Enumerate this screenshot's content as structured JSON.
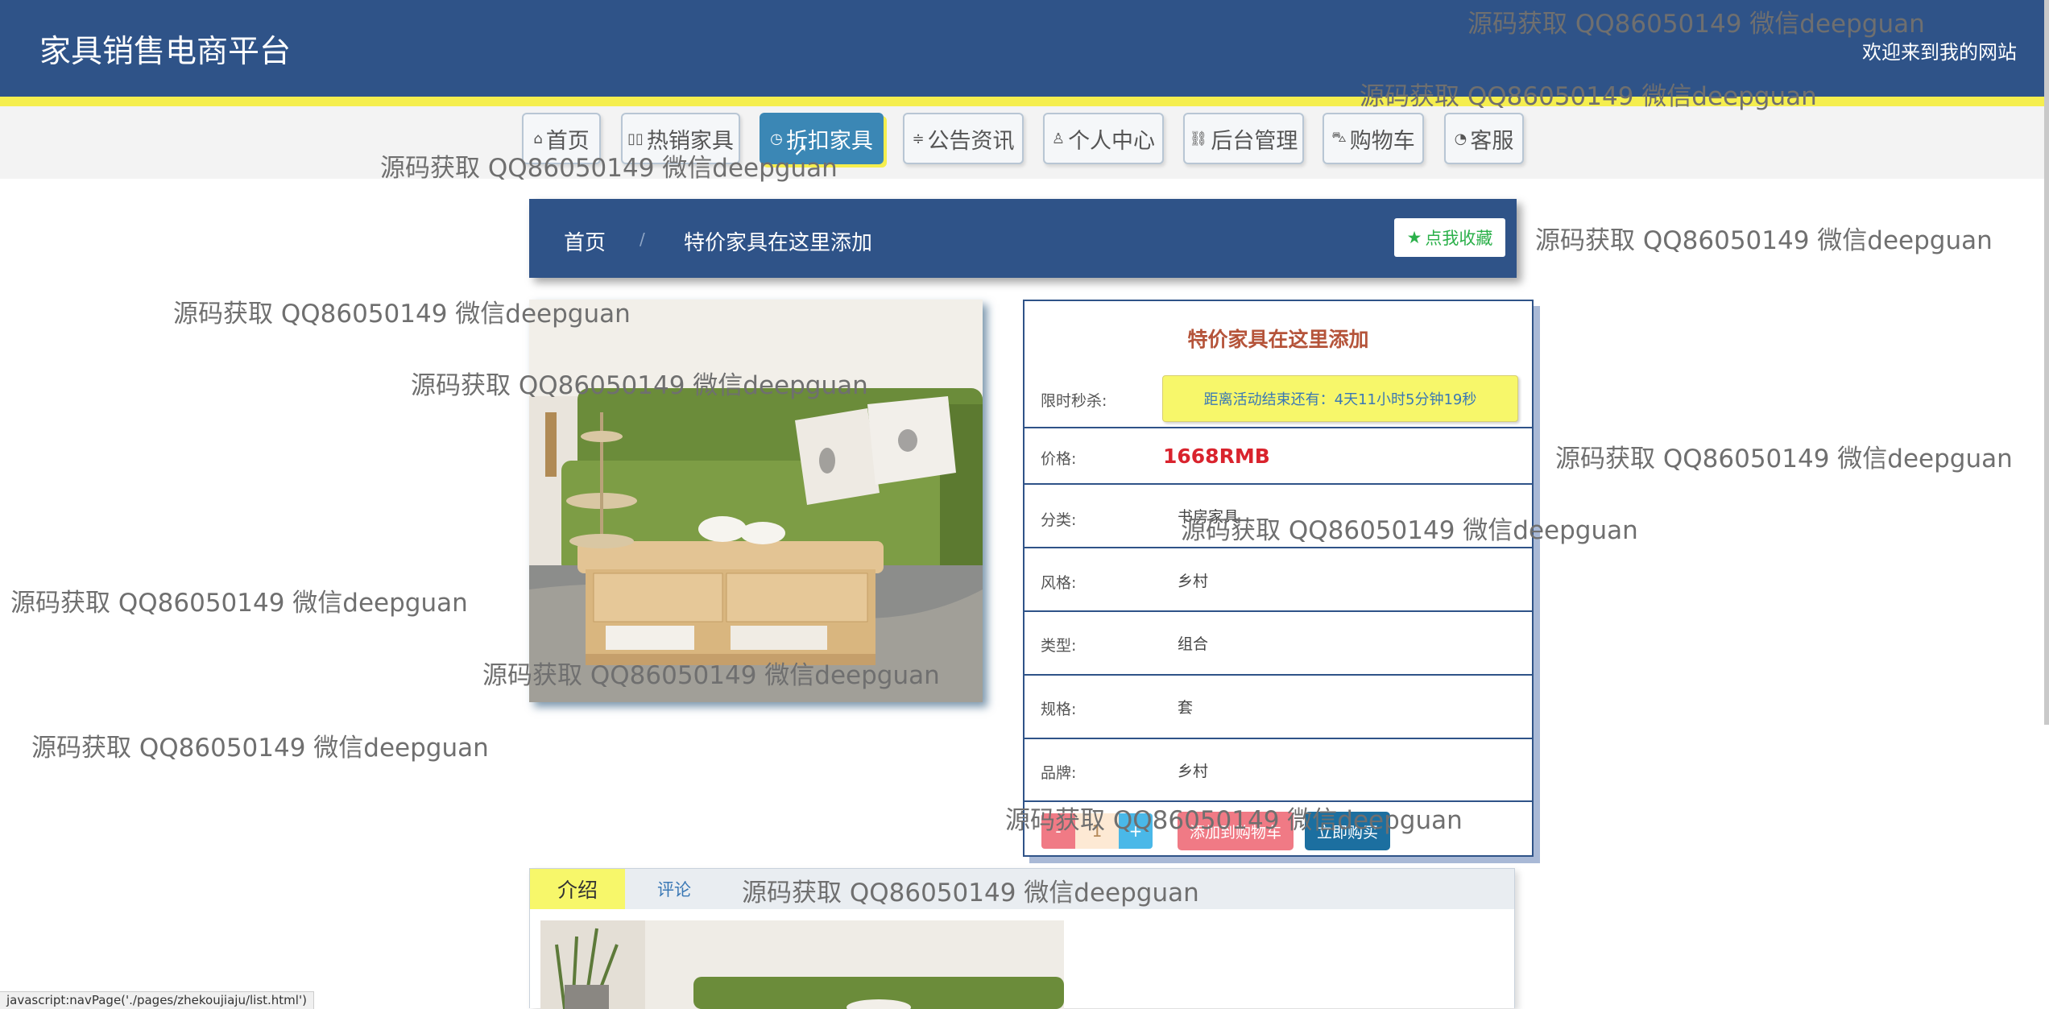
{
  "header": {
    "brand": "家具销售电商平台",
    "welcome": "欢迎来到我的网站"
  },
  "nav": [
    {
      "label": "首页",
      "icon": "home-icon",
      "glyph": "⌂"
    },
    {
      "label": "热销家具",
      "icon": "grid-icon",
      "glyph": "▯▯"
    },
    {
      "label": "折扣家具",
      "icon": "clock-icon",
      "glyph": "◷",
      "active": true
    },
    {
      "label": "公告资讯",
      "icon": "sliders-icon",
      "glyph": "≑"
    },
    {
      "label": "个人中心",
      "icon": "user-icon",
      "glyph": "♙"
    },
    {
      "label": "后台管理",
      "icon": "link-icon",
      "glyph": "⛓"
    },
    {
      "label": "购物车",
      "icon": "cart-icon",
      "glyph": "⛍"
    },
    {
      "label": "客服",
      "icon": "chat-icon",
      "glyph": "◔"
    }
  ],
  "breadcrumb": {
    "home": "首页",
    "separator": "/",
    "current": "特价家具在这里添加",
    "fav_label": "点我收藏"
  },
  "product": {
    "title": "特价家具在这里添加",
    "countdown_label": "限时秒杀:",
    "countdown_text": "距离活动结束还有：4天11小时5分钟19秒",
    "price_label": "价格:",
    "price": "1668RMB",
    "rows": [
      {
        "label": "分类:",
        "value": "书房家具"
      },
      {
        "label": "风格:",
        "value": "乡村"
      },
      {
        "label": "类型:",
        "value": "组合"
      },
      {
        "label": "规格:",
        "value": "套"
      },
      {
        "label": "品牌:",
        "value": "乡村"
      }
    ],
    "qty_minus": "-",
    "qty_value": "1",
    "qty_plus": "+",
    "add_to_cart": "添加到购物车",
    "buy_now": "立即购买"
  },
  "tabs": {
    "intro": "介绍",
    "review": "评论"
  },
  "watermark": "源码获取 QQ86050149 微信deepguan",
  "status_url": "javascript:navPage('./pages/zhekoujiaju/list.html')",
  "colors": {
    "header": "#2f5388",
    "accent_yellow": "#f5ee4e",
    "price_red": "#d9232d"
  }
}
